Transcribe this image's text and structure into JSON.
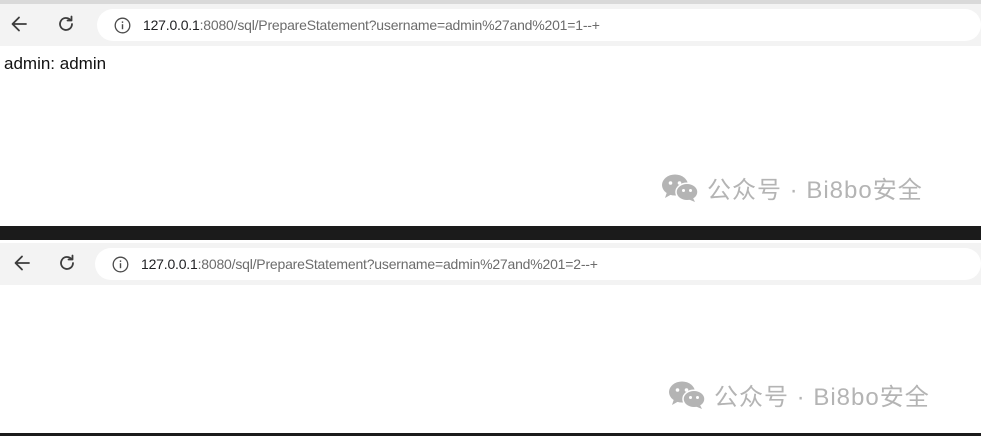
{
  "windows": [
    {
      "url_host": "127.0.0.1",
      "url_rest": ":8080/sql/PrepareStatement?username=admin%27and%201=1--+",
      "body_text": "admin: admin",
      "watermark": "公众号 · Bi8bo安全"
    },
    {
      "url_host": "127.0.0.1",
      "url_rest": ":8080/sql/PrepareStatement?username=admin%27and%201=2--+",
      "body_text": "",
      "watermark": "公众号 · Bi8bo安全"
    }
  ],
  "icons": {
    "back": "back-arrow-icon",
    "reload": "reload-icon",
    "info": "info-icon",
    "wechat": "wechat-icon"
  },
  "colors": {
    "toolbar_bg": "#f3f3f3",
    "url_host": "#202124",
    "url_path": "#6c6c6c",
    "watermark": "#b4b4b4",
    "divider": "#1b1b1b"
  }
}
